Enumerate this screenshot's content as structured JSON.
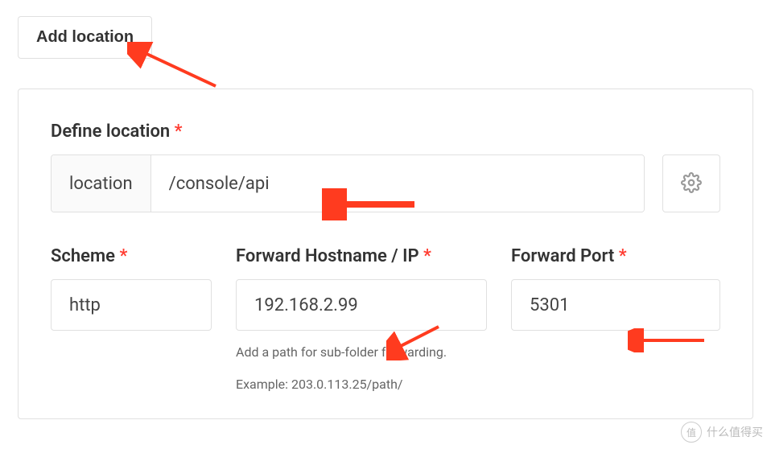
{
  "add_location_button": "Add location",
  "define_location": {
    "label": "Define location",
    "prefix": "location",
    "value": "/console/api"
  },
  "scheme": {
    "label": "Scheme",
    "value": "http"
  },
  "hostname": {
    "label": "Forward Hostname / IP",
    "value": "192.168.2.99",
    "helper1": "Add a path for sub-folder forwarding.",
    "helper2": "Example: 203.0.113.25/path/"
  },
  "port": {
    "label": "Forward Port",
    "value": "5301"
  },
  "watermark": "什么值得买"
}
